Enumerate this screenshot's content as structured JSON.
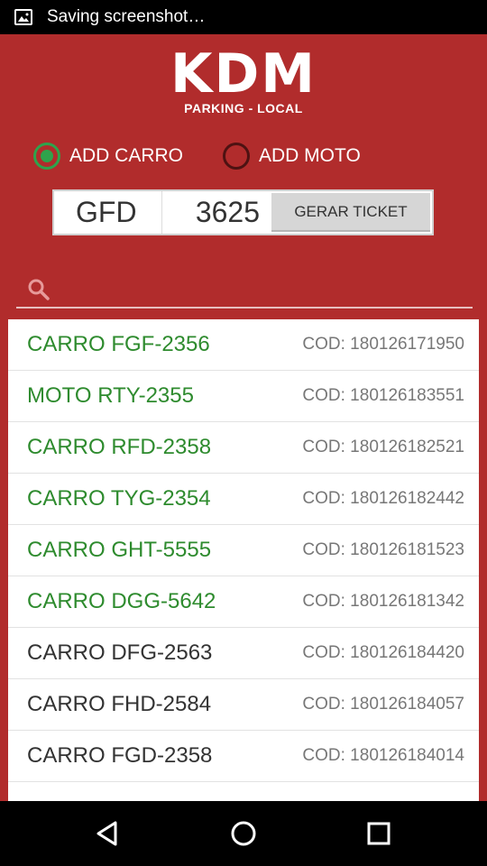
{
  "status_bar": {
    "text": "Saving screenshot…",
    "icon": "image-icon"
  },
  "logo": {
    "title": "KDM",
    "subtitle": "PARKING - LOCAL"
  },
  "vehicle_type": {
    "options": [
      {
        "label": "ADD CARRO",
        "checked": true
      },
      {
        "label": "ADD MOTO",
        "checked": false
      }
    ]
  },
  "ticket_form": {
    "plate_letters": "GFD",
    "plate_numbers": "3625",
    "button_label": "GERAR TICKET"
  },
  "search": {
    "placeholder": "",
    "icon": "search-icon"
  },
  "colors": {
    "active": "#2e8b2e",
    "inactive": "#333333",
    "brand_red": "#b12c2c",
    "radio_checked": "#2ea34c"
  },
  "tickets": [
    {
      "label": "CARRO FGF-2356",
      "code": "COD: 180126171950",
      "active": true
    },
    {
      "label": "MOTO RTY-2355",
      "code": "COD: 180126183551",
      "active": true
    },
    {
      "label": "CARRO RFD-2358",
      "code": "COD: 180126182521",
      "active": true
    },
    {
      "label": "CARRO TYG-2354",
      "code": "COD: 180126182442",
      "active": true
    },
    {
      "label": "CARRO GHT-5555",
      "code": "COD: 180126181523",
      "active": true
    },
    {
      "label": "CARRO DGG-5642",
      "code": "COD: 180126181342",
      "active": true
    },
    {
      "label": "CARRO DFG-2563",
      "code": "COD: 180126184420",
      "active": false
    },
    {
      "label": "CARRO FHD-2584",
      "code": "COD: 180126184057",
      "active": false
    },
    {
      "label": "CARRO FGD-2358",
      "code": "COD: 180126184014",
      "active": false
    }
  ],
  "nav_bar": {
    "icons": [
      "back-icon",
      "home-icon",
      "recents-icon"
    ]
  }
}
